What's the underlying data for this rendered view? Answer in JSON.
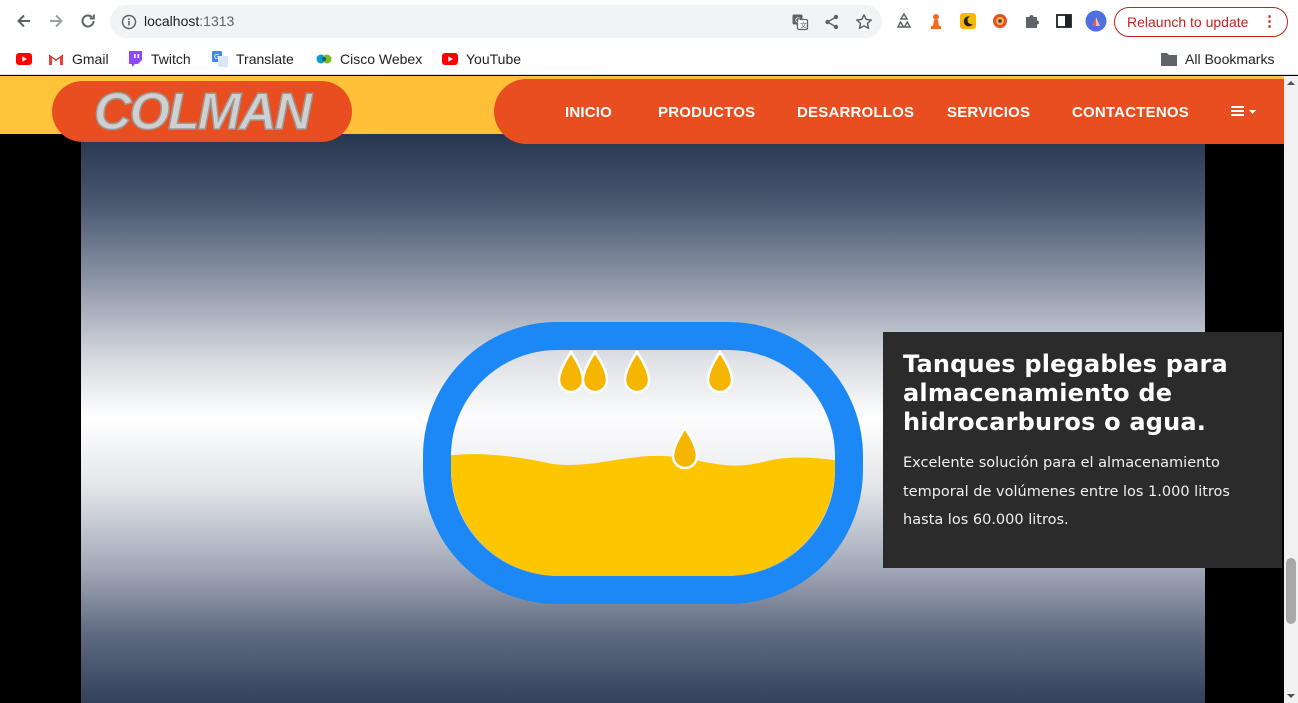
{
  "browser": {
    "url_host": "localhost",
    "url_port": ":1313",
    "relaunch_label": "Relaunch to update",
    "menu_dots": "⋮",
    "bookmarks": [
      {
        "label": ""
      },
      {
        "label": "Gmail"
      },
      {
        "label": "Twitch"
      },
      {
        "label": "Translate"
      },
      {
        "label": "Cisco Webex"
      },
      {
        "label": "YouTube"
      }
    ],
    "all_bookmarks": "All Bookmarks"
  },
  "site": {
    "logo_text": "COLMAN",
    "nav": [
      "INICIO",
      "PRODUCTOS",
      "DESARROLLOS",
      "SERVICIOS",
      "CONTACTENOS"
    ],
    "menu_icon": "≣ ▾"
  },
  "hero": {
    "title": "Tanques plegables para almacenamiento de hidrocarburos o agua.",
    "text": "Excelente solución para el almacenamiento temporal de volúmenes entre los 1.000 litros hasta los 60.000 litros."
  },
  "colors": {
    "brand_orange": "#e84e1f",
    "brand_yellow": "#ffc43a",
    "tank_blue": "#1c88f5",
    "liquid_yellow": "#fdc600",
    "caption_bg": "#2b2b2b"
  }
}
